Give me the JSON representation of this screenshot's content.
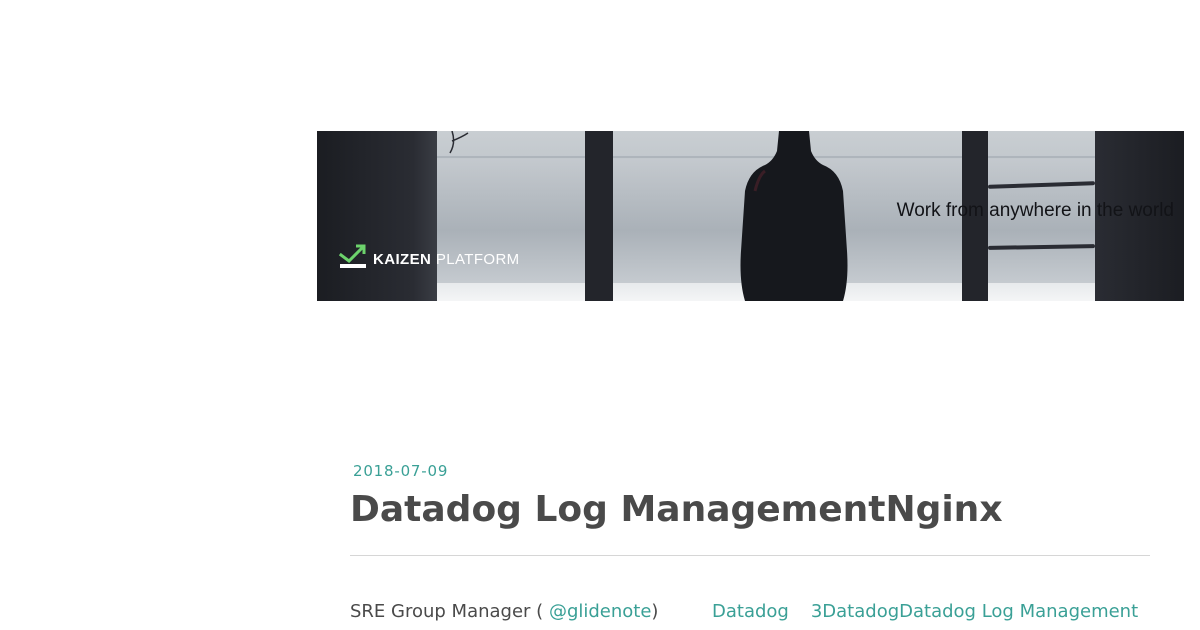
{
  "banner": {
    "brand_bold": "KAIZEN",
    "brand_light": "PLATFORM",
    "tagline": "Work from anywhere in the world",
    "accent_color": "#6dd36c"
  },
  "post": {
    "date": "2018-07-09",
    "title": "Datadog Log ManagementNginx",
    "author_role": "SRE Group Manager (",
    "author_handle": "@glidenote",
    "author_close": ")",
    "tags": [
      "Datadog",
      "3Datadog",
      "Datadog Log Management"
    ]
  },
  "colors": {
    "link": "#3aa096",
    "text": "#4a4a4a"
  }
}
